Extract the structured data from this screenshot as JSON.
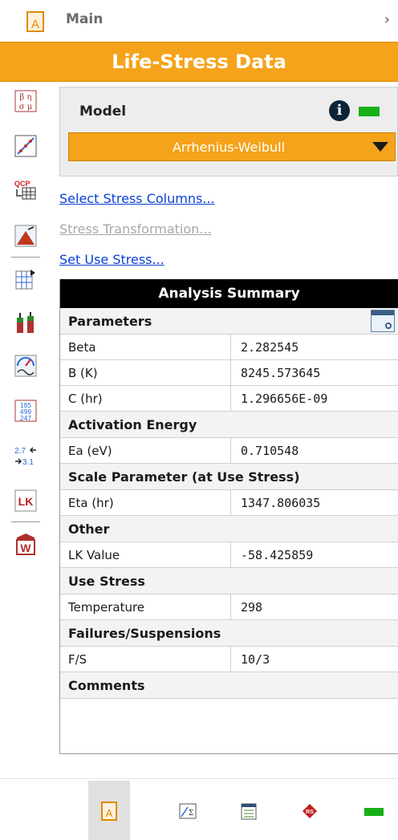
{
  "topbar": {
    "main_label": "Main",
    "chevron": "›"
  },
  "title": "Life-Stress Data",
  "model": {
    "label": "Model",
    "info_icon": "info-icon",
    "selected": "Arrhenius-Weibull"
  },
  "links": {
    "select_stress": "Select Stress Columns...",
    "stress_transformation": "Stress Transformation...",
    "set_use_stress": "Set Use Stress..."
  },
  "summary": {
    "header": "Analysis Summary",
    "sections": {
      "parameters": "Parameters",
      "activation": "Activation Energy",
      "scale": "Scale Parameter (at Use Stress)",
      "other": "Other",
      "use_stress": "Use Stress",
      "failures": "Failures/Suspensions",
      "comments": "Comments"
    },
    "rows": {
      "beta": {
        "k": "Beta",
        "v": "2.282545"
      },
      "b": {
        "k": "B (K)",
        "v": "8245.573645"
      },
      "c": {
        "k": "C (hr)",
        "v": "1.296656E-09"
      },
      "ea": {
        "k": "Ea (eV)",
        "v": "0.710548"
      },
      "eta": {
        "k": "Eta (hr)",
        "v": "1347.806035"
      },
      "lk": {
        "k": "LK Value",
        "v": "-58.425859"
      },
      "temp": {
        "k": "Temperature",
        "v": "298"
      },
      "fs": {
        "k": "F/S",
        "v": "10/3"
      }
    }
  },
  "toolbar_labels": {
    "beta_eta": "β η σ μ",
    "qcp": "QCP",
    "table_nums": "1 8 5 4 9 0 2 4 7",
    "transform_top": "2.7",
    "transform_bottom": "3.1",
    "lk": "LK",
    "report": "W",
    "app_letter": "A",
    "rs": "RS"
  },
  "colors": {
    "accent": "#f5a31a",
    "status_green": "#16b016",
    "link": "#0b3fd6"
  }
}
